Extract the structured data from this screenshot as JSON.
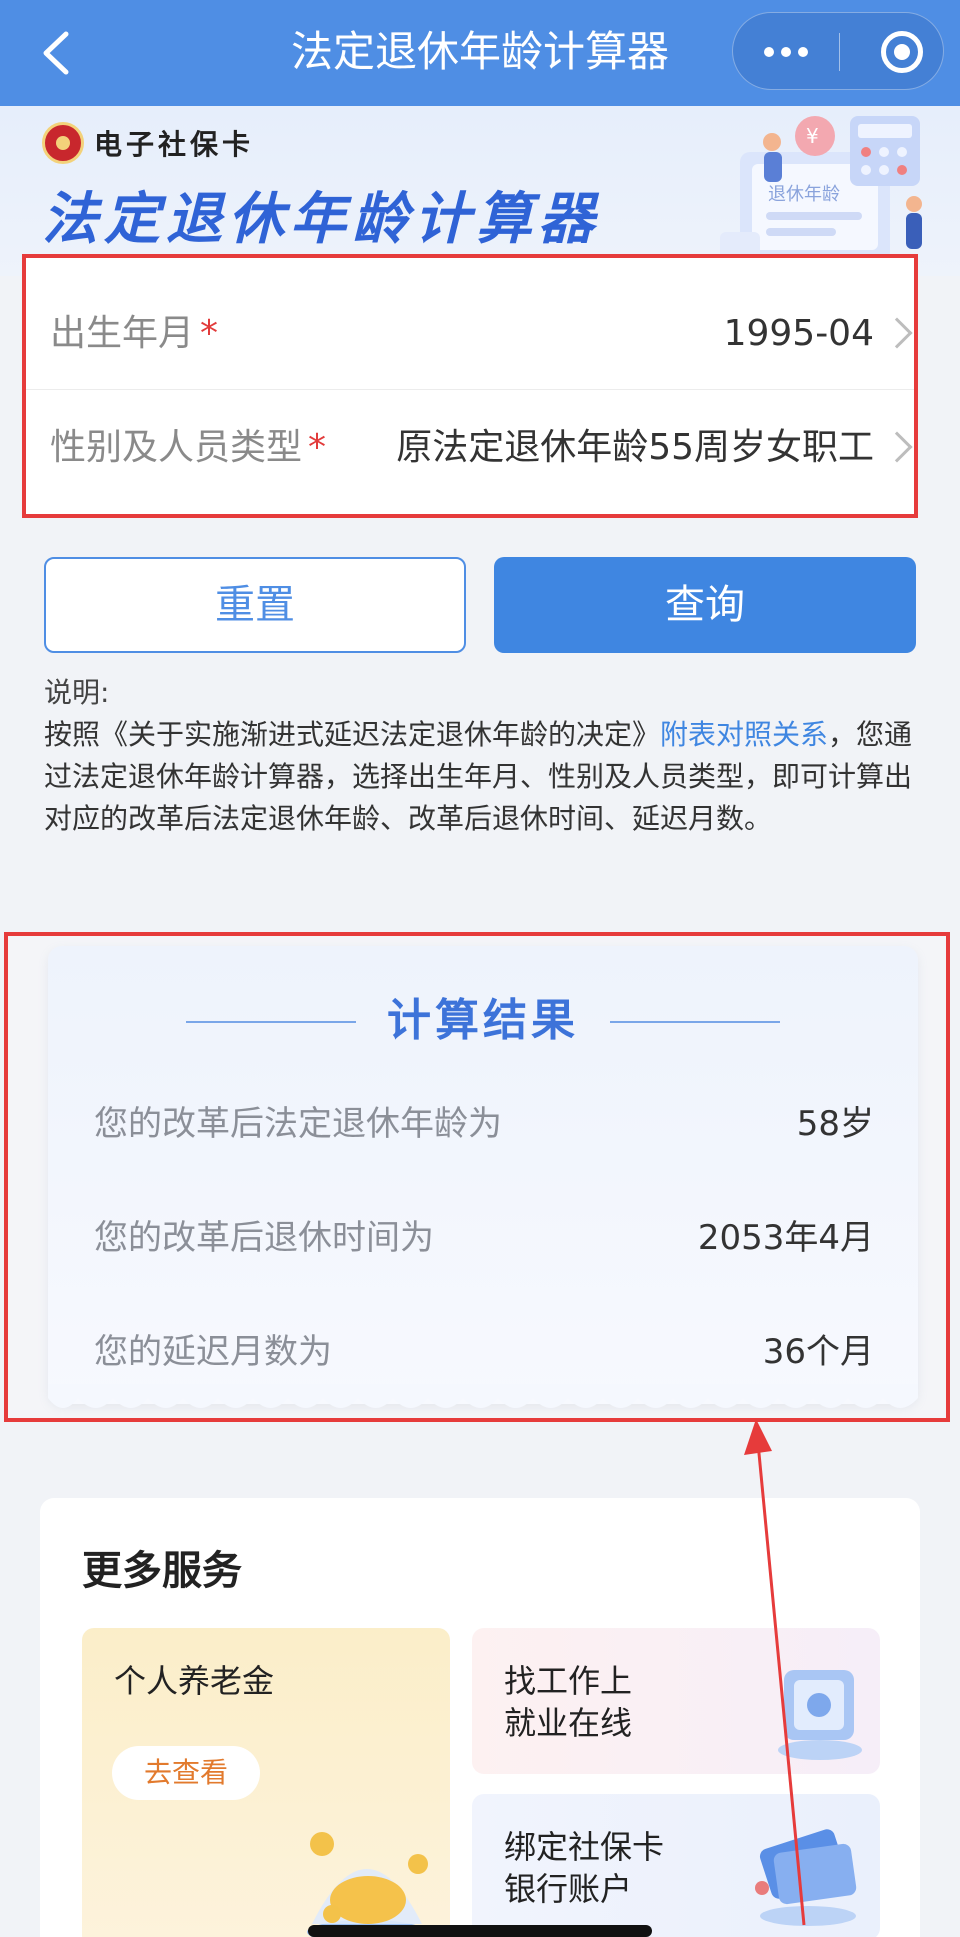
{
  "navbar": {
    "title": "法定退休年龄计算器",
    "back_icon": "chevron-left-icon",
    "more_icon": "more-dots-icon",
    "close_icon": "target-circle-icon"
  },
  "banner": {
    "brand": "电子社保卡",
    "title": "法定退休年龄计算器",
    "illustration_label": "退休年龄"
  },
  "form": {
    "birth": {
      "label": "出生年月",
      "required_mark": "*",
      "value": "1995-04"
    },
    "type": {
      "label": "性别及人员类型",
      "required_mark": "*",
      "value": "原法定退休年龄55周岁女职工"
    }
  },
  "buttons": {
    "reset": "重置",
    "query": "查询"
  },
  "description": {
    "label": "说明:",
    "prefix": "按照",
    "doc": "《关于实施渐进式延迟法定退休年龄的决定》",
    "link": "附表对照关系",
    "suffix": "，您通过法定退休年龄计算器，选择出生年月、性别及人员类型，即可计算出对应的改革后法定退休年龄、改革后退休时间、延迟月数。"
  },
  "result": {
    "title": "计算结果",
    "rows": [
      {
        "label": "您的改革后法定退休年龄为",
        "value": "58岁"
      },
      {
        "label": "您的改革后退休时间为",
        "value": "2053年4月"
      },
      {
        "label": "您的延迟月数为",
        "value": "36个月"
      }
    ]
  },
  "more": {
    "title": "更多服务",
    "pension": {
      "title": "个人养老金",
      "button": "去查看"
    },
    "job": {
      "line1": "找工作上",
      "line2": "就业在线"
    },
    "bank": {
      "line1": "绑定社保卡",
      "line2": "银行账户"
    }
  },
  "colors": {
    "primary": "#4f8ee4",
    "highlight_border": "#e63b3b",
    "result_title": "#3d73d9"
  }
}
